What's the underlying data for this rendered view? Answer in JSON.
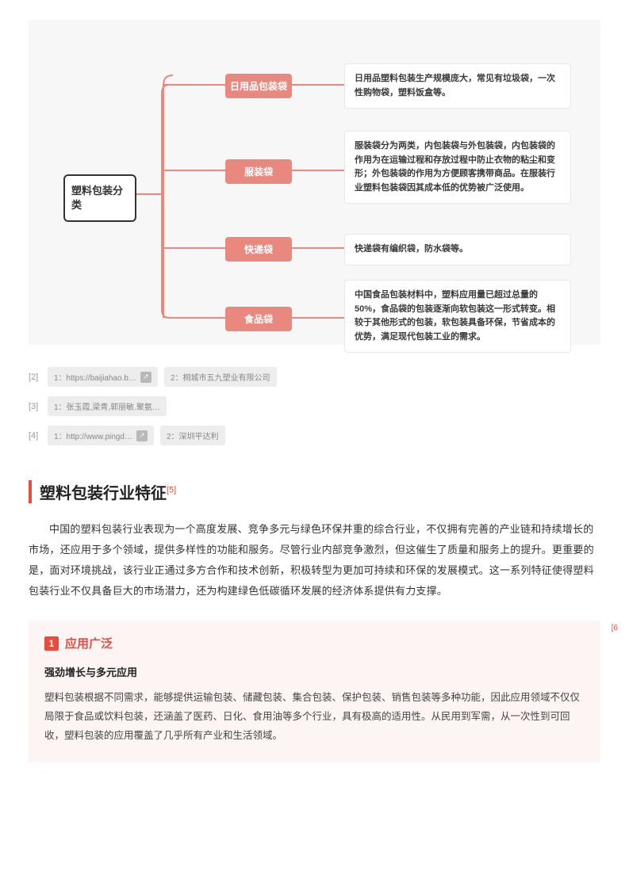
{
  "diagram": {
    "root": "塑料包装分类",
    "nodes": [
      {
        "label": "日用品包装袋",
        "desc": "日用品塑料包装生产规模庞大，常见有垃圾袋，一次性购物袋，塑料饭盒等。",
        "catTop": 68,
        "descTop": 55
      },
      {
        "label": "服装袋",
        "desc": "服装袋分为两类，内包装袋与外包装袋，内包装袋的作用为在运输过程和存放过程中防止衣物的粘尘和变形；外包装袋的作用为方便顾客携带商品。在服装行业塑料包装袋因其成本低的优势被广泛使用。",
        "catTop": 176,
        "descTop": 140
      },
      {
        "label": "快递袋",
        "desc": "快递袋有编织袋，防水袋等。",
        "catTop": 274,
        "descTop": 270
      },
      {
        "label": "食品袋",
        "desc": "中国食品包装材料中，塑料应用量已超过总量的50%，食品袋的包装逐渐向软包装这一形式转变。相较于其他形式的包装，软包装具备环保，节省成本的优势，满足现代包装工业的需求。",
        "catTop": 362,
        "descTop": 328
      }
    ]
  },
  "refs": [
    {
      "idx": "[2]",
      "items": [
        {
          "text": "1：https://baijiahao.b…",
          "icon": true
        },
        {
          "text": "2：桐城市五九塑业有限公司",
          "icon": false
        }
      ]
    },
    {
      "idx": "[3]",
      "items": [
        {
          "text": "1：张玉霞,梁青,郭丽敏.聚氨…",
          "icon": false
        }
      ]
    },
    {
      "idx": "[4]",
      "items": [
        {
          "text": "1：http://www.pingd…",
          "icon": true
        },
        {
          "text": "2：深圳平达利",
          "icon": false
        }
      ]
    }
  ],
  "section": {
    "title": "塑料包装行业特征",
    "footnote": "[5]",
    "para": "中国的塑料包装行业表现为一个高度发展、竞争多元与绿色环保并重的综合行业，不仅拥有完善的产业链和持续增长的市场，还应用于多个领域，提供多样性的功能和服务。尽管行业内部竞争激烈，但这催生了质量和服务上的提升。更重要的是，面对环境挑战，该行业正通过多方合作和技术创新，积极转型为更加可持续和环保的发展模式。这一系列特征使得塑料包装行业不仅具备巨大的市场潜力，还为构建绿色低碳循环发展的经济体系提供有力支撑。"
  },
  "feature": {
    "num": "1",
    "title": "应用广泛",
    "sideRef": "[6",
    "sub": "强劲增长与多元应用",
    "body": "塑料包装根据不同需求，能够提供运输包装、储藏包装、集合包装、保护包装、销售包装等多种功能，因此应用领域不仅仅局限于食品或饮料包装，还涵盖了医药、日化、食用油等多个行业，具有极高的适用性。从民用到军需，从一次性到可回收，塑料包装的应用覆盖了几乎所有产业和生活领域。"
  }
}
